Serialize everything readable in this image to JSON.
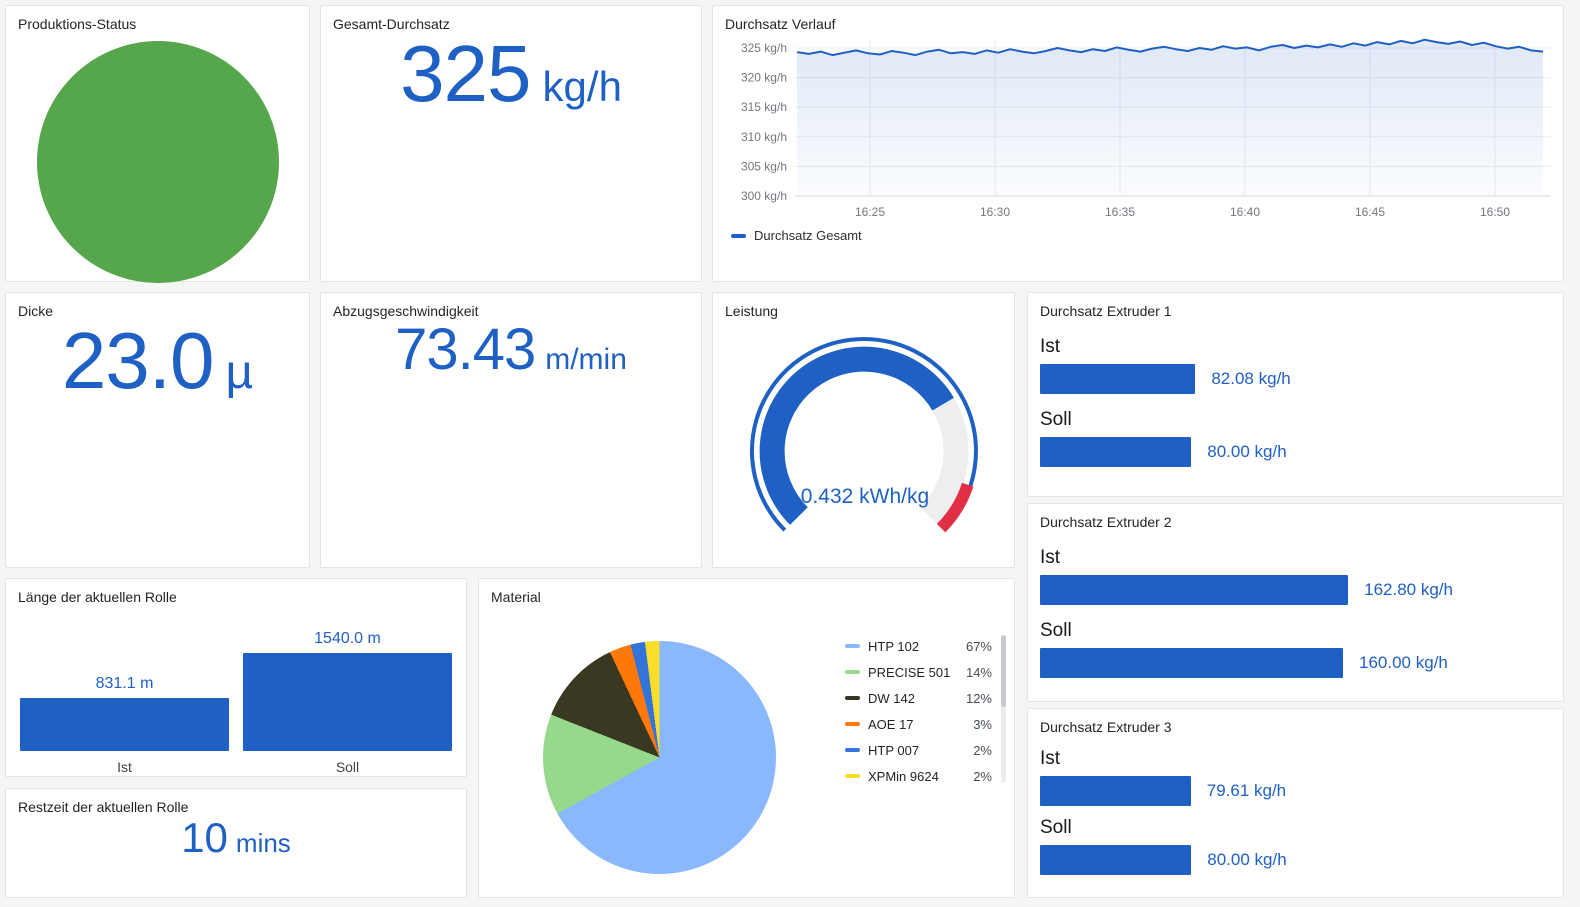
{
  "colors": {
    "accent": "#1F60C4",
    "status_green": "#56A64B",
    "threshold_red": "#E02F44",
    "page_background": "#F4F5F5",
    "panel_background": "#FFFFFF"
  },
  "panels": {
    "produktions_status": {
      "title": "Produktions-Status",
      "status_color": "#56A64B"
    },
    "gesamt_durchsatz": {
      "title": "Gesamt-Durchsatz",
      "value": "325",
      "unit": "kg/h"
    },
    "dicke": {
      "title": "Dicke",
      "value": "23.0",
      "unit": "µ"
    },
    "abzugsgeschwindigkeit": {
      "title": "Abzugsgeschwindigkeit",
      "value": "73.43",
      "unit": "m/min"
    },
    "restzeit": {
      "title": "Restzeit der aktuellen Rolle",
      "value": "10",
      "unit": "mins"
    }
  },
  "chart_data": [
    {
      "type": "line",
      "title": "Durchsatz Verlauf",
      "y_unit": "kg/h",
      "y_tick_values": [
        325,
        320,
        315,
        310,
        305,
        300
      ],
      "y_tick_labels": [
        "325 kg/h",
        "320 kg/h",
        "315 kg/h",
        "310 kg/h",
        "305 kg/h",
        "300 kg/h"
      ],
      "x_ticks": [
        "16:25",
        "16:30",
        "16:35",
        "16:40",
        "16:45",
        "16:50"
      ],
      "ylim": [
        300,
        327.5
      ],
      "grid": true,
      "legend_position": "bottom",
      "series": [
        {
          "name": "Durchsatz Gesamt",
          "color": "#1F60C4",
          "values": [
            324.3,
            324.0,
            324.4,
            323.8,
            324.2,
            324.6,
            324.1,
            323.9,
            324.5,
            324.2,
            323.8,
            324.4,
            324.7,
            324.1,
            324.3,
            324.0,
            324.6,
            324.2,
            324.8,
            324.4,
            324.1,
            324.5,
            325.0,
            324.6,
            324.3,
            324.8,
            324.5,
            325.1,
            324.7,
            324.4,
            324.9,
            325.2,
            324.8,
            324.5,
            325.0,
            324.7,
            325.3,
            324.9,
            325.1,
            324.6,
            325.2,
            325.5,
            325.0,
            325.4,
            325.1,
            325.6,
            325.2,
            325.8,
            325.4,
            326.0,
            325.6,
            326.2,
            325.8,
            326.4,
            326.0,
            325.7,
            326.1,
            325.5,
            325.9,
            325.3,
            324.9,
            325.2,
            324.6,
            324.4
          ]
        }
      ]
    },
    {
      "type": "gauge",
      "title": "Leistung",
      "value": 0.432,
      "unit": "kWh/kg",
      "display": "0.432 kWh/kg",
      "min": 0,
      "max": 0.6,
      "threshold_red": 0.54,
      "color": "#1F60C4",
      "threshold_color": "#E02F44"
    },
    {
      "type": "pie",
      "title": "Material",
      "labels": [
        "HTP 102",
        "PRECISE 501",
        "DW 142",
        "AOE 17",
        "HTP 007",
        "XPMin 9624"
      ],
      "values": [
        67,
        14,
        12,
        3,
        2,
        2
      ],
      "percent_labels": [
        "67%",
        "14%",
        "12%",
        "3%",
        "2%",
        "2%"
      ],
      "colors": [
        "#8AB8FF",
        "#96D98D",
        "#3A3820",
        "#FF780A",
        "#3274D9",
        "#FADE2A"
      ],
      "legend_position": "right"
    },
    {
      "type": "bar",
      "title": "Länge der aktuellen Rolle",
      "categories": [
        "Ist",
        "Soll"
      ],
      "values": [
        831.1,
        1540.0
      ],
      "value_labels": [
        "831.1 m",
        "1540.0 m"
      ],
      "unit": "m",
      "max": 1600,
      "color": "#1F60C4"
    },
    {
      "type": "bar",
      "orientation": "horizontal",
      "title": "Durchsatz Extruder 1",
      "categories": [
        "Ist",
        "Soll"
      ],
      "values": [
        82.08,
        80.0
      ],
      "value_labels": [
        "82.08 kg/h",
        "80.00 kg/h"
      ],
      "unit": "kg/h",
      "max": 270,
      "color": "#1F60C4"
    },
    {
      "type": "bar",
      "orientation": "horizontal",
      "title": "Durchsatz Extruder 2",
      "categories": [
        "Ist",
        "Soll"
      ],
      "values": [
        162.8,
        160.0
      ],
      "value_labels": [
        "162.80 kg/h",
        "160.00 kg/h"
      ],
      "unit": "kg/h",
      "max": 270,
      "color": "#1F60C4"
    },
    {
      "type": "bar",
      "orientation": "horizontal",
      "title": "Durchsatz Extruder 3",
      "categories": [
        "Ist",
        "Soll"
      ],
      "values": [
        79.61,
        80.0
      ],
      "value_labels": [
        "79.61 kg/h",
        "80.00 kg/h"
      ],
      "unit": "kg/h",
      "max": 270,
      "color": "#1F60C4"
    }
  ]
}
